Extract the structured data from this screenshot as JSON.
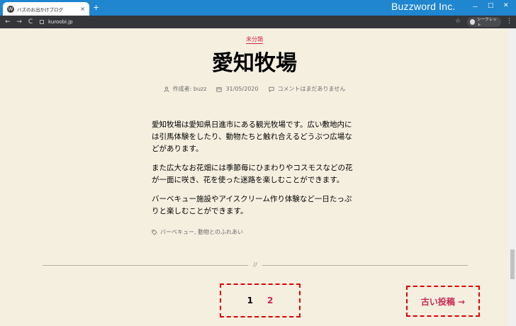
{
  "browser": {
    "tab_title": "バズのお出かけブログ",
    "tab_close": "×",
    "new_tab": "+",
    "brand": "Buzzword Inc.",
    "minimize": "－",
    "maximize": "□",
    "close": "✕",
    "back": "←",
    "forward": "→",
    "reload": "C",
    "url": "kuroobi.jp",
    "star": "☆",
    "incognito_label": "シークレット",
    "menu": "⋮"
  },
  "post": {
    "category": "未分類",
    "title": "愛知牧場",
    "author_label": "作成者: buzz",
    "date": "31/05/2020",
    "comments": "コメントはまだありません",
    "paragraphs": [
      "愛知牧場は愛知県日進市にある観光牧場です。広い敷地内には引馬体験をしたり、動物たちと触れ合えるどうぶつ広場などがあります。",
      "また広大なお花畑には季節毎にひまわりやコスモスなどの花が一面に咲き、花を使った迷路を楽しむことができます。",
      "バーベキュー施設やアイスクリーム作り体験など一日たっぷりと楽しむことができます。"
    ],
    "tags": "バーベキュー, 動物とのふれあい"
  },
  "nav": {
    "divider_mark": "//",
    "current_page": "1",
    "next_page": "2",
    "older_posts": "古い投稿 →"
  },
  "colors": {
    "accent": "#cd2653",
    "background": "#f5efe0",
    "highlight": "#e00000"
  }
}
